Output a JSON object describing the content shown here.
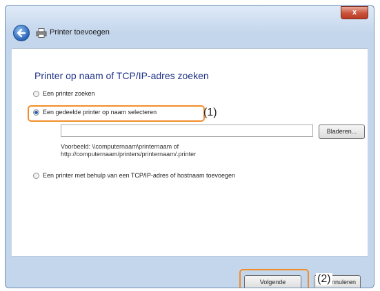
{
  "window": {
    "title": "Printer toevoegen",
    "close_label": "x"
  },
  "heading": "Printer op naam of TCP/IP-adres zoeken",
  "options": [
    {
      "label": "Een printer zoeken",
      "selected": false
    },
    {
      "label": "Een gedeelde printer op naam selecteren",
      "selected": true
    },
    {
      "label": "Een printer met behulp van een TCP/IP-adres of hostnaam toevoegen",
      "selected": false
    }
  ],
  "printer_name_input": {
    "value": "",
    "placeholder": ""
  },
  "browse_label": "Bladeren...",
  "example_line1": "Voorbeeld: \\\\computernaam\\printernaam of",
  "example_line2": "http://computernaam/printers/printernaam/.printer",
  "callouts": [
    "(1)",
    "(2)"
  ],
  "footer": {
    "next_label": "Volgende",
    "cancel_label": "Annuleren"
  },
  "colors": {
    "accent": "#1e3287",
    "highlight": "#f28c28",
    "close": "#c9523b"
  },
  "icons": [
    "back-arrow-icon",
    "printer-icon",
    "close-icon"
  ]
}
